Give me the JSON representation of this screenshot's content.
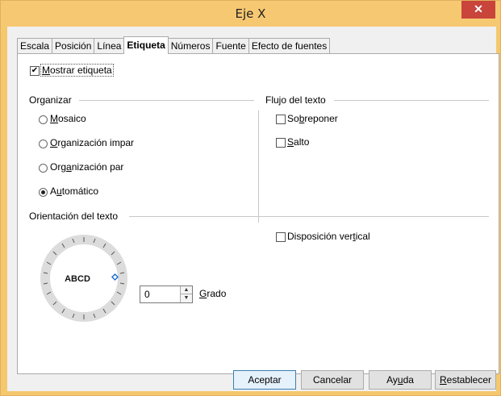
{
  "window": {
    "title": "Eje X",
    "close_glyph": "✕"
  },
  "tabs": [
    "Escala",
    "Posición",
    "Línea",
    "Etiqueta",
    "Números",
    "Fuente",
    "Efecto de fuentes"
  ],
  "active_tab": "Etiqueta",
  "show_label": {
    "pre": "",
    "key": "M",
    "post": "ostrar etiqueta",
    "checked": true
  },
  "organize": {
    "title": "Organizar",
    "options": [
      {
        "pre": "",
        "key": "M",
        "post": "osaico",
        "selected": false
      },
      {
        "pre": "",
        "key": "O",
        "post": "rganización impar",
        "selected": false
      },
      {
        "pre": "Org",
        "key": "a",
        "post": "nización par",
        "selected": false
      },
      {
        "pre": "A",
        "key": "u",
        "post": "tomático",
        "selected": true
      }
    ]
  },
  "text_flow": {
    "title": "Flujo del texto",
    "overlap": {
      "pre": "So",
      "key": "b",
      "post": "reponer",
      "checked": false
    },
    "break": {
      "pre": "",
      "key": "S",
      "post": "alto",
      "checked": false
    }
  },
  "orientation": {
    "title": "Orientación del texto",
    "dial_text": "ABCD",
    "degrees_value": "0",
    "degrees_label": {
      "pre": "",
      "key": "G",
      "post": "rado"
    },
    "vertical": {
      "pre": "Disposición ver",
      "key": "t",
      "post": "ical",
      "checked": false
    }
  },
  "buttons": {
    "ok": {
      "label": "Aceptar"
    },
    "cancel": {
      "label": "Cancelar"
    },
    "help": {
      "pre": "Ay",
      "key": "u",
      "post": "da"
    },
    "reset": {
      "pre": "",
      "key": "R",
      "post": "establecer"
    }
  }
}
